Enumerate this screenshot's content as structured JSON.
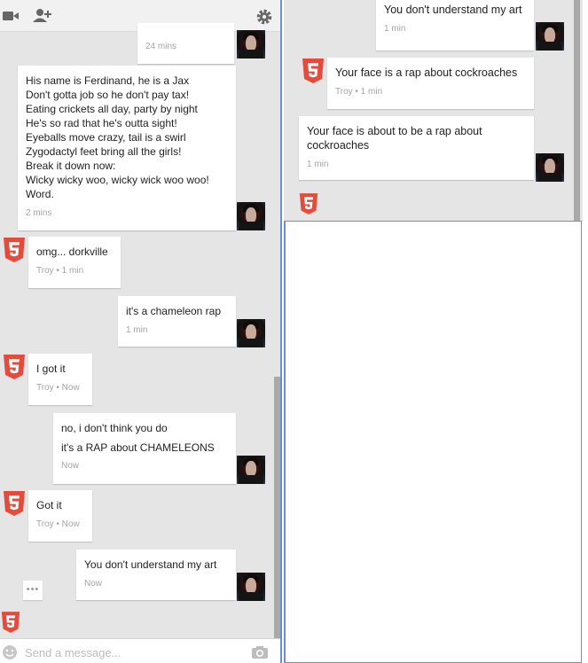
{
  "left": {
    "toolbar": {
      "video_icon": "video-camera-icon",
      "add_person_icon": "add-person-icon",
      "settings_icon": "gear-icon"
    },
    "messages": [
      {
        "text": "",
        "meta": "24 mins",
        "sender": "me"
      },
      {
        "text": "His name is Ferdinand, he is a Jax\nDon't gotta job so he don't pay tax!\nEating crickets all day, party by night\nHe's so rad that he's outta sight!\nEyeballs move crazy, tail is a swirl\nZygodactyl feet bring all the girls!\nBreak it down now:\nWicky wicky woo, wicky wick woo woo!\nWord.",
        "meta": "2 mins",
        "sender": "me"
      },
      {
        "text": "omg... dorkville",
        "meta": "Troy • 1 min",
        "sender": "troy"
      },
      {
        "text": "it's a chameleon rap",
        "meta": "1 min",
        "sender": "me"
      },
      {
        "text": "I got it",
        "meta": "Troy • Now",
        "sender": "troy"
      },
      {
        "text": "no, i don't think you do\nit's a RAP about CHAMELEONS",
        "meta": "Now",
        "sender": "me"
      },
      {
        "text": "Got it",
        "meta": "Troy • Now",
        "sender": "troy"
      },
      {
        "text": "You don't understand my art",
        "meta": "Now",
        "sender": "me"
      }
    ],
    "typing": "•••",
    "input": {
      "placeholder": "Send a message...",
      "emoji_icon": "smiley-icon",
      "camera_icon": "camera-icon"
    }
  },
  "right": {
    "messages": [
      {
        "text": "You don't understand my art",
        "meta": "1 min",
        "sender": "me"
      },
      {
        "text": "Your face is a rap about cockroaches",
        "meta": "Troy • 1 min",
        "sender": "troy"
      },
      {
        "text": "Your face is about to be a rap about\ncockroaches",
        "meta": "1 min",
        "sender": "me"
      }
    ]
  },
  "colors": {
    "chat_bg": "#e5e5e5",
    "html5_red": "#e44d26",
    "focus_border": "#6b8ed6",
    "meta_gray": "#a4a4a4"
  }
}
